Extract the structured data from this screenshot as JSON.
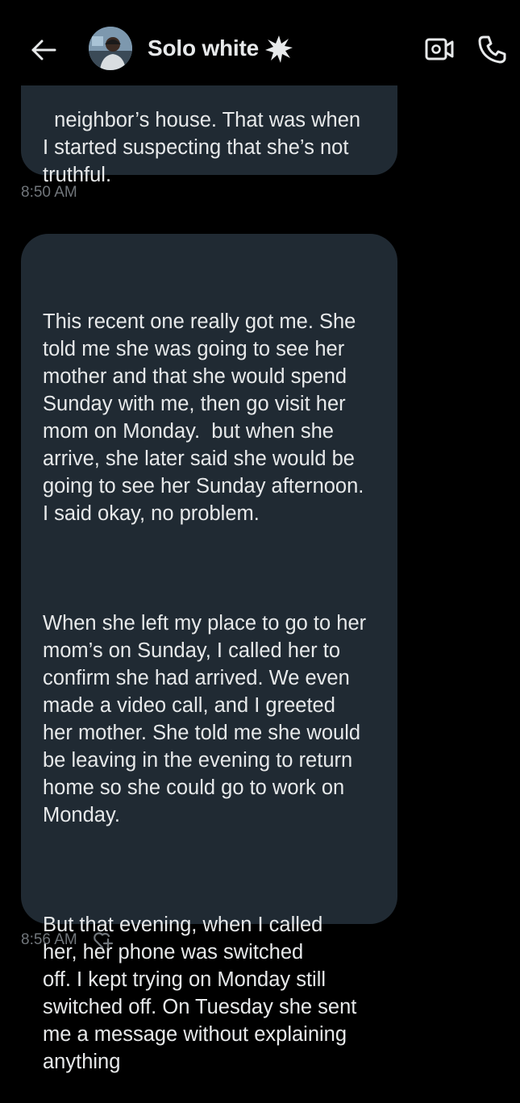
{
  "header": {
    "contact_name": "Solo white",
    "badge_icon": "sparkle-badge-icon",
    "actions": [
      "video-call-icon",
      "phone-call-icon"
    ]
  },
  "messages": [
    {
      "text": "neighbor’s house. That was when\nI started suspecting that she’s not\ntruthful.",
      "time": "8:50 AM"
    },
    {
      "paragraphs": [
        "This recent one really got me. She\ntold me she was going to see her\nmother and that she would spend\nSunday with me, then go visit her\nmom on Monday.  but when she\narrive, she later said she would be\ngoing to see her Sunday afternoon.\nI said okay, no problem.",
        "When she left my place to go to her\nmom’s on Sunday, I called her to\nconfirm she had arrived. We even\nmade a video call, and I greeted\nher mother. She told me she would\nbe leaving in the evening to return\nhome so she could go to work on\nMonday.",
        "But that evening, when I called\nher, her phone was switched\noff. I kept trying on Monday still\nswitched off. On Tuesday she sent\nme a message without explaining\nanything"
      ],
      "time": "8:56 AM"
    }
  ],
  "colors": {
    "background": "#000000",
    "bubble": "#202a33",
    "text": "#e7e9ea",
    "muted": "#71767b"
  }
}
